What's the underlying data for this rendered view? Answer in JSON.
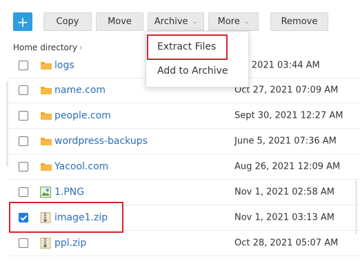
{
  "toolbar": {
    "add_label": "+",
    "copy_label": "Copy",
    "move_label": "Move",
    "archive_label": "Archive",
    "more_label": "More",
    "remove_label": "Remove"
  },
  "breadcrumb": {
    "home_label": "Home directory",
    "separator": "›"
  },
  "archive_menu": {
    "items": [
      "Extract Files",
      "Add to Archive"
    ]
  },
  "files": [
    {
      "name": "logs",
      "date": "31, 2021 03:44 AM",
      "type": "folder",
      "checked": false
    },
    {
      "name": "name.com",
      "date": "Oct 27, 2021 07:09 AM",
      "type": "folder",
      "checked": false
    },
    {
      "name": "people.com",
      "date": "Sept 30, 2021 12:27 AM",
      "type": "folder",
      "checked": false
    },
    {
      "name": "wordpress-backups",
      "date": "June 5, 2021 07:36 AM",
      "type": "folder",
      "checked": false
    },
    {
      "name": "Yacool.com",
      "date": "Aug 26, 2021 12:09 AM",
      "type": "folder",
      "checked": false
    },
    {
      "name": "1.PNG",
      "date": "Nov 1, 2021 02:58 AM",
      "type": "image",
      "checked": false
    },
    {
      "name": "image1.zip",
      "date": "Nov 1, 2021 03:13 AM",
      "type": "zip",
      "checked": true
    },
    {
      "name": "ppl.zip",
      "date": "Oct 28, 2021 05:07 AM",
      "type": "zip",
      "checked": false
    }
  ],
  "colors": {
    "accent": "#2f9de0",
    "link": "#2a6fb8",
    "folder": "#f5a623",
    "highlight": "#d6202a"
  }
}
